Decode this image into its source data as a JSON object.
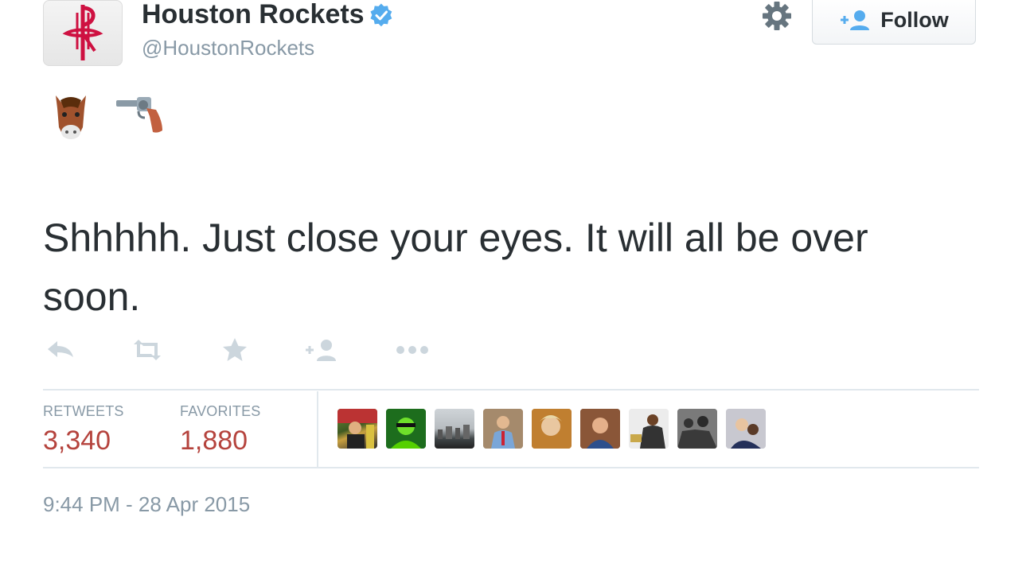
{
  "header": {
    "display_name": "Houston Rockets",
    "screen_name": "@HoustonRockets",
    "verified": true,
    "follow_label": "Follow"
  },
  "tweet": {
    "emojis": [
      "horse-face-emoji",
      "pistol-emoji"
    ],
    "text": "Shhhhh. Just close your eyes. It will all be over soon."
  },
  "actions": [
    "reply-icon",
    "retweet-icon",
    "favorite-icon",
    "follow-icon",
    "more-icon"
  ],
  "stats": {
    "retweets_label": "RETWEETS",
    "retweets_value": "3,340",
    "favorites_label": "FAVORITES",
    "favorites_value": "1,880"
  },
  "timestamp": "9:44 PM - 28 Apr 2015",
  "colors": {
    "stat_value": "#b5433d",
    "muted": "#8899a6",
    "verified_blue": "#55acee",
    "rockets_red": "#ce1141"
  }
}
